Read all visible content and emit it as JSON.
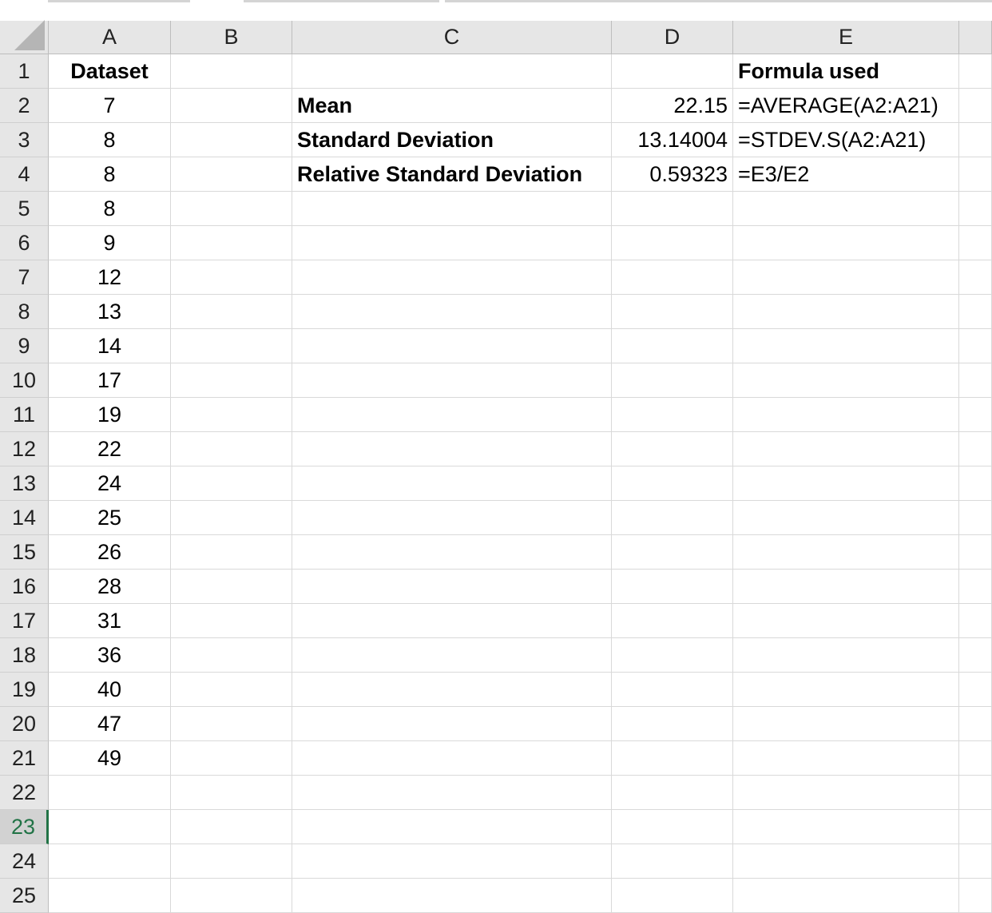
{
  "columns": [
    "A",
    "B",
    "C",
    "D",
    "E"
  ],
  "rows": [
    {
      "n": "1",
      "A": "Dataset",
      "C": "",
      "D": "",
      "E": "Formula used"
    },
    {
      "n": "2",
      "A": "7",
      "C": "Mean",
      "D": "22.15",
      "E": "=AVERAGE(A2:A21)"
    },
    {
      "n": "3",
      "A": "8",
      "C": "Standard Deviation",
      "D": "13.14004",
      "E": "=STDEV.S(A2:A21)"
    },
    {
      "n": "4",
      "A": "8",
      "C": "Relative Standard Deviation",
      "D": "0.59323",
      "E": "=E3/E2"
    },
    {
      "n": "5",
      "A": "8"
    },
    {
      "n": "6",
      "A": "9"
    },
    {
      "n": "7",
      "A": "12"
    },
    {
      "n": "8",
      "A": "13"
    },
    {
      "n": "9",
      "A": "14"
    },
    {
      "n": "10",
      "A": "17"
    },
    {
      "n": "11",
      "A": "19"
    },
    {
      "n": "12",
      "A": "22"
    },
    {
      "n": "13",
      "A": "24"
    },
    {
      "n": "14",
      "A": "25"
    },
    {
      "n": "15",
      "A": "26"
    },
    {
      "n": "16",
      "A": "28"
    },
    {
      "n": "17",
      "A": "31"
    },
    {
      "n": "18",
      "A": "36"
    },
    {
      "n": "19",
      "A": "40"
    },
    {
      "n": "20",
      "A": "47"
    },
    {
      "n": "21",
      "A": "49"
    },
    {
      "n": "22"
    },
    {
      "n": "23"
    },
    {
      "n": "24"
    },
    {
      "n": "25"
    }
  ],
  "active_row": "23",
  "accent_color": "#217346"
}
